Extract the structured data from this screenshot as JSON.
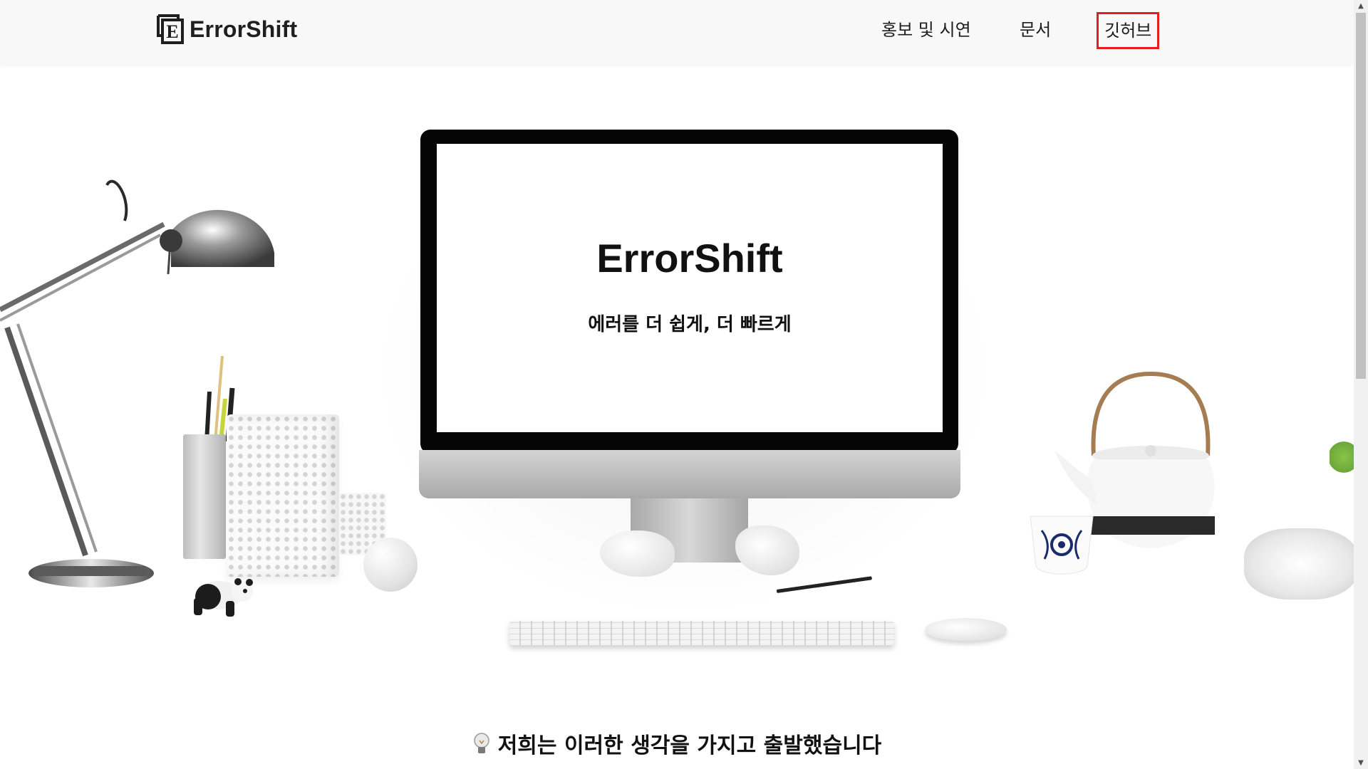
{
  "header": {
    "logo_text": "ErrorShift",
    "nav": [
      {
        "label": "홍보 및 시연"
      },
      {
        "label": "문서"
      },
      {
        "label": "깃허브"
      }
    ]
  },
  "hero": {
    "screen_title": "ErrorShift",
    "screen_subtitle": "에러를 더 쉽게, 더 빠르게"
  },
  "section": {
    "heading": "저희는 이러한 생각을 가지고 출발했습니다",
    "heading_icon": "lightbulb-icon"
  },
  "colors": {
    "highlight_border": "#e02020",
    "text": "#111111",
    "header_bg": "#f8f8f9"
  },
  "scrollbar": {
    "up_glyph": "▲",
    "down_glyph": "▼"
  }
}
